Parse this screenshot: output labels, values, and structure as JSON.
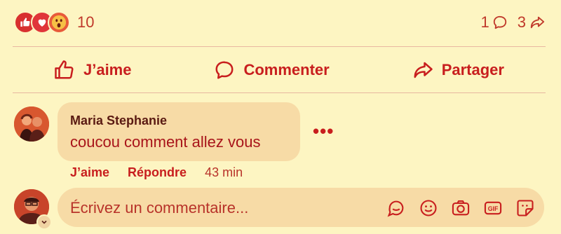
{
  "reactions": {
    "count": "10",
    "icons": [
      "like-icon",
      "love-icon",
      "wow-icon"
    ]
  },
  "stats": {
    "comments": "1",
    "shares": "3"
  },
  "actions": {
    "like": "J’aime",
    "comment": "Commenter",
    "share": "Partager"
  },
  "comment": {
    "author": "Maria Stephanie",
    "text": "coucou comment allez vous",
    "like_label": "J’aime",
    "reply_label": "Répondre",
    "time": "43 min",
    "more": "•••"
  },
  "composer": {
    "placeholder": "Écrivez un commentaire..."
  },
  "colors": {
    "background": "#fdf5c2",
    "accent": "#c81e1e",
    "bubble": "#f7dba6"
  }
}
